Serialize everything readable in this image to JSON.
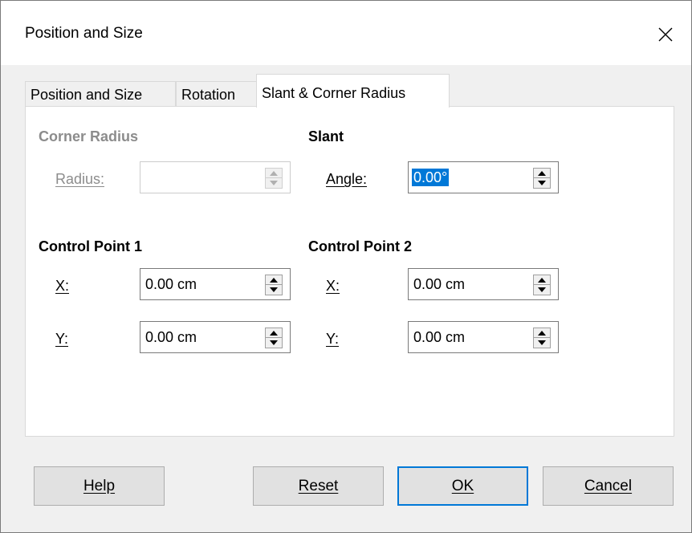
{
  "window": {
    "title": "Position and Size"
  },
  "tabs": [
    {
      "label": "Position and Size",
      "active": false
    },
    {
      "label": "Rotation",
      "active": false
    },
    {
      "label": "Slant & Corner Radius",
      "active": true
    }
  ],
  "corner_radius": {
    "heading": "Corner Radius",
    "radius_label": "Radius:",
    "radius_value": "",
    "enabled": false
  },
  "slant": {
    "heading": "Slant",
    "angle_label": "Angle:",
    "angle_value": "0.00°"
  },
  "control_point_1": {
    "heading": "Control Point 1",
    "x_label": "X:",
    "x_value": "0.00 cm",
    "y_label": "Y:",
    "y_value": "0.00 cm"
  },
  "control_point_2": {
    "heading": "Control Point 2",
    "x_label": "X:",
    "x_value": "0.00 cm",
    "y_label": "Y:",
    "y_value": "0.00 cm"
  },
  "buttons": {
    "help": "Help",
    "reset": "Reset",
    "ok": "OK",
    "cancel": "Cancel"
  },
  "icons": {
    "close": "close-icon",
    "spin_up": "chevron-up-icon",
    "spin_down": "chevron-down-icon"
  },
  "colors": {
    "accent": "#0078d7",
    "disabled_text": "#8c8c8c"
  }
}
